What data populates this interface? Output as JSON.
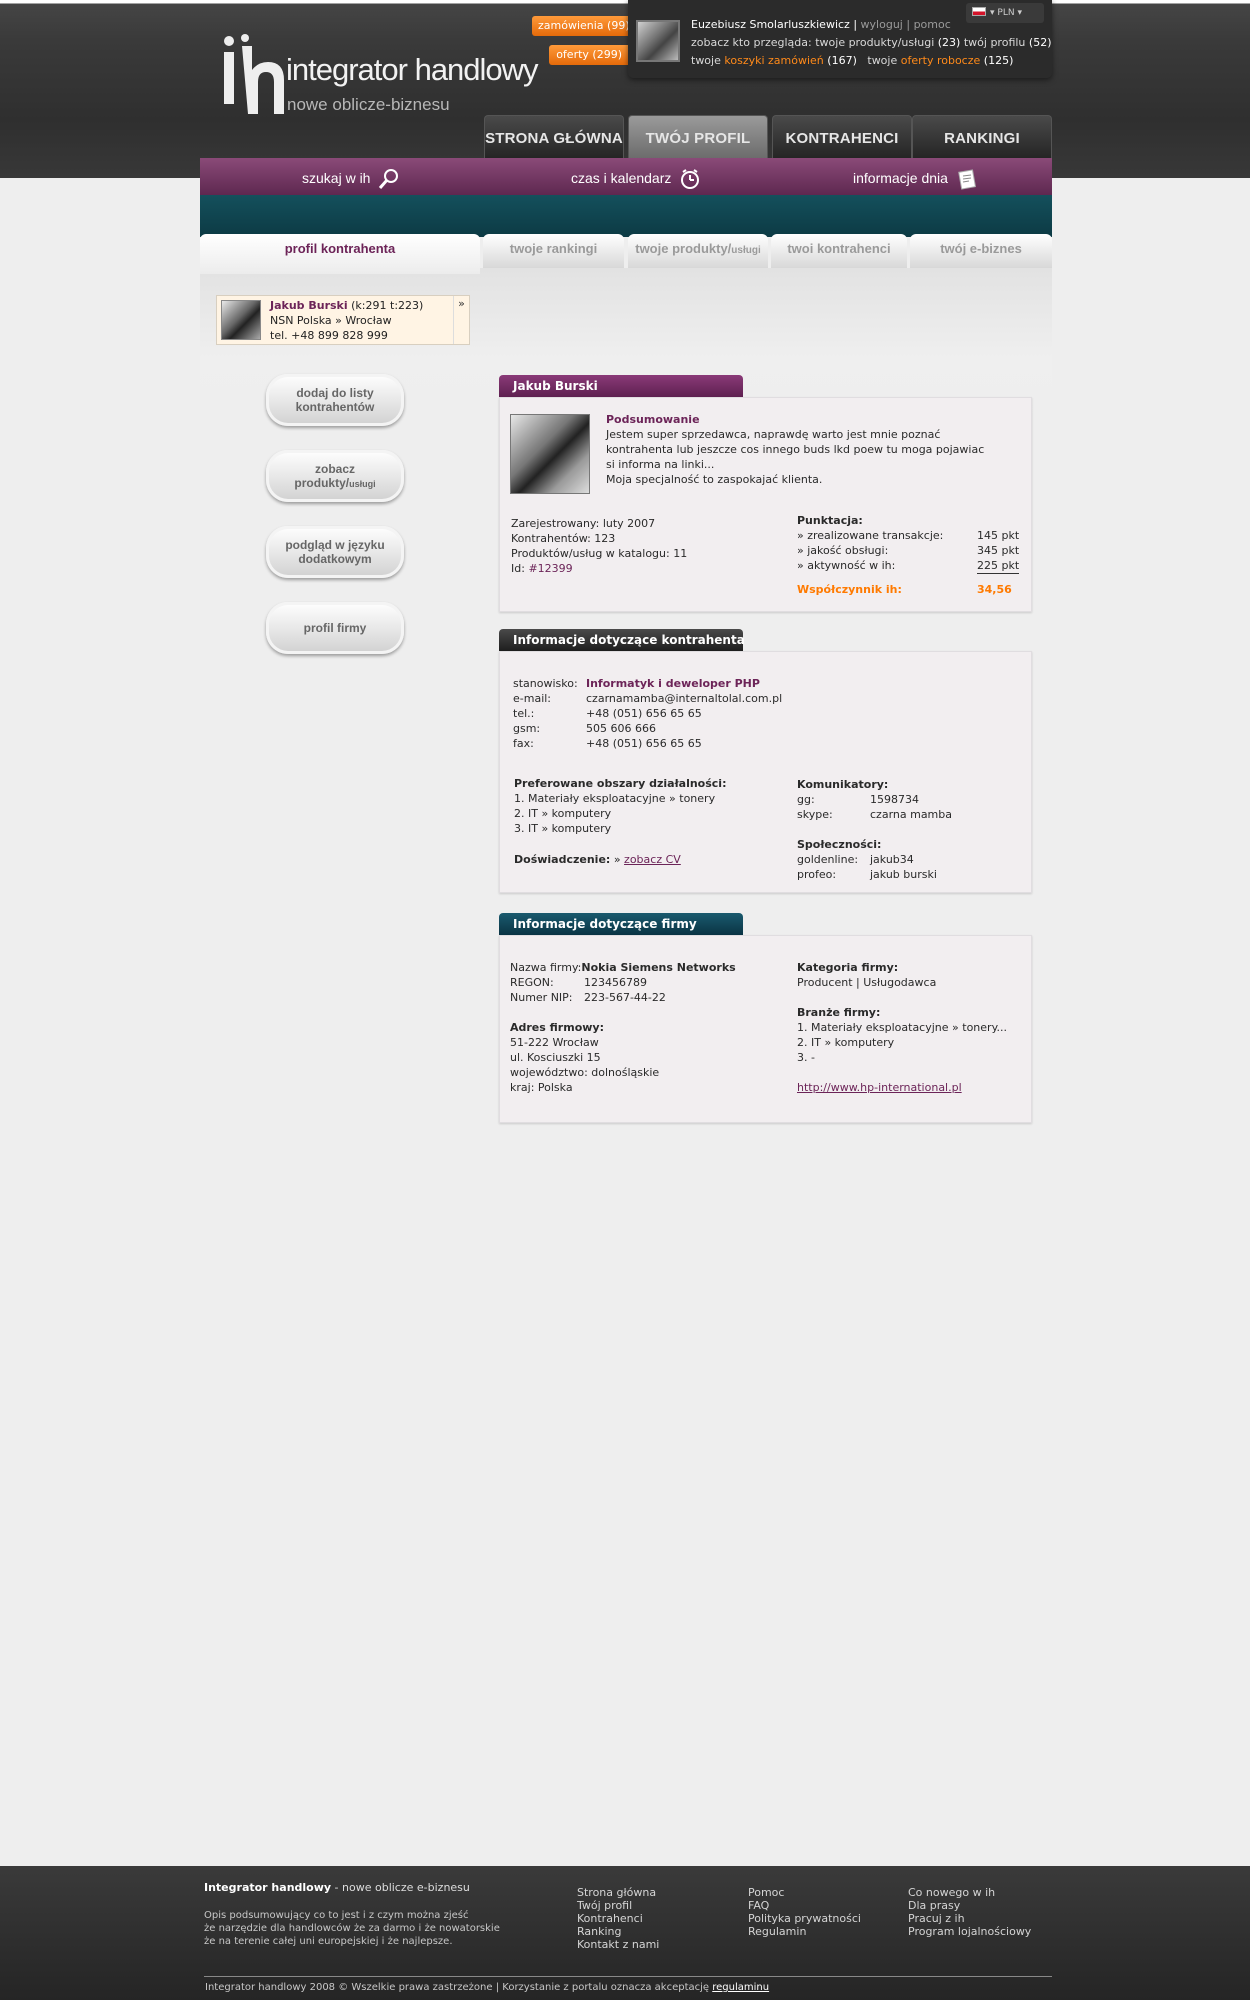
{
  "header": {
    "logo_text": "integrator handlowy",
    "logo_tagline": "nowe oblicze-biznesu",
    "orders_badge": "zamówienia (99)",
    "offers_badge": "oferty (299)",
    "currency": "PLN",
    "user": {
      "name": "Euzebiusz Smolarluszkiewicz",
      "sep1": "|",
      "logout": "wyloguj",
      "sep2": "|",
      "help": "pomoc",
      "views_prefix": "zobacz kto przegląda:",
      "views_products": "twoje produkty/usługi",
      "views_products_count": "(23)",
      "views_profile": "twój profilu",
      "views_profile_count": "(52)",
      "carts_prefix": "twoje",
      "carts_link": "koszyki zamówień",
      "carts_count": "(167)",
      "drafts_prefix": "twoje",
      "drafts_link": "oferty robocze",
      "drafts_count": "(125)"
    },
    "nav": [
      "STRONA GŁÓWNA",
      "TWÓJ PROFIL",
      "KONTRAHENCI",
      "RANKINGI"
    ],
    "toolbar": {
      "search": "szukaj w ih",
      "calendar": "czas i kalendarz",
      "news": "informacje dnia"
    }
  },
  "subtabs": {
    "profile": "profil kontrahenta",
    "rankings": "twoje rankingi",
    "products_main": "twoje produkty/",
    "products_small": "usługi",
    "contractors": "twoi kontrahenci",
    "ebusiness": "twój e-biznes"
  },
  "contact_card": {
    "name": "Jakub Burski",
    "stats": "(k:291 t:223)",
    "company": "NSN Polska » Wrocław",
    "phone": "tel. +48 899 828 999",
    "more": "»"
  },
  "side_buttons": {
    "add": "dodaj do listy kontrahentów",
    "products_main": "zobacz produkty/",
    "products_small": "usługi",
    "language": "podgląd w języku dodatkowym",
    "company": "profil firmy"
  },
  "summary": {
    "header": "Jakub Burski",
    "title": "Podsumowanie",
    "lines": [
      "Jestem super sprzedawca, naprawdę warto jest mnie poznać",
      "kontrahenta lub jeszcze cos innego buds lkd poew tu moga pojawiac",
      "si informa na linki...",
      "Moja specjalność to zaspokajać klienta."
    ],
    "registered": "Zarejestrowany: luty 2007",
    "contractors": "Kontrahentów: 123",
    "products": "Produktów/usług w katalogu: 11",
    "id_label": "Id:",
    "id_value": "#12399",
    "points_title": "Punktacja:",
    "points": [
      {
        "label": "» zrealizowane transakcje:",
        "value": "145 pkt"
      },
      {
        "label": "» jakość obsługi:",
        "value": "345 pkt"
      },
      {
        "label": "» aktywność w ih:",
        "value": "225 pkt"
      }
    ],
    "factor_label": "Współczynnik ih:",
    "factor_value": "34,56"
  },
  "contractor_info": {
    "header": "Informacje dotyczące kontrahenta",
    "fields": [
      {
        "label": "stanowisko:",
        "value": "Informatyk i deweloper PHP"
      },
      {
        "label": "e-mail:",
        "value": "czarnamamba@internaltolal.com.pl"
      },
      {
        "label": "tel.:",
        "value": "+48 (051) 656 65 65"
      },
      {
        "label": "gsm:",
        "value": "505 606 666"
      },
      {
        "label": "fax:",
        "value": "+48 (051) 656 65 65"
      }
    ],
    "areas_title": "Preferowane obszary działalności:",
    "areas": [
      "1. Materiały eksploatacyjne » tonery",
      "2. IT » komputery",
      "3. IT » komputery"
    ],
    "experience_label": "Doświadczenie:",
    "experience_prefix": "»",
    "experience_link": "zobacz CV",
    "messengers_title": "Komunikatory:",
    "messengers": [
      {
        "label": "gg:",
        "value": "1598734"
      },
      {
        "label": "skype:",
        "value": "czarna mamba"
      }
    ],
    "communities_title": "Społeczności:",
    "communities": [
      {
        "label": "goldenline:",
        "value": "jakub34"
      },
      {
        "label": "profeo:",
        "value": "jakub burski"
      }
    ]
  },
  "company_info": {
    "header": "Informacje dotyczące firmy",
    "name_label": "Nazwa firmy:",
    "name_value": "Nokia Siemens Networks",
    "regon_label": "REGON:",
    "regon_value": "123456789",
    "nip_label": "Numer NIP:",
    "nip_value": "223-567-44-22",
    "address_title": "Adres firmowy:",
    "address": [
      "51-222 Wrocław",
      "ul. Kosciuszki 15",
      "województwo: dolnośląskie",
      "kraj: Polska"
    ],
    "category_title": "Kategoria firmy:",
    "category": "Producent | Usługodawca",
    "branches_title": "Branże firmy:",
    "branches": [
      "1. Materiały eksploatacyjne » tonery...",
      "2. IT » komputery",
      "3. -"
    ],
    "website": "http://www.hp-international.pl"
  },
  "footer": {
    "brand": "Integrator handlowy",
    "brand_suffix": " - nowe oblicze e-biznesu",
    "desc": [
      "Opis podsumowujący co to jest i z czym można zjeść",
      "że narzędzie dla handlowców że za darmo i że nowatorskie",
      "że na terenie całej uni europejskiej i że najlepsze."
    ],
    "col1": [
      "Strona główna",
      "Twój profil",
      "Kontrahenci",
      "Ranking",
      "Kontakt z nami"
    ],
    "col2": [
      "Pomoc",
      "FAQ",
      "Polityka prywatności",
      "Regulamin"
    ],
    "col3": [
      "Co nowego w ih",
      "Dla prasy",
      "Pracuj z ih",
      "Program lojalnościowy"
    ],
    "copyright": "Integrator handlowy 2008 © Wszelkie prawa zastrzeżone  |  Korzystanie z portalu oznacza akceptację",
    "terms_link": "regulaminu"
  },
  "colors": {
    "accent_purple": "#6c2458",
    "accent_orange": "#ff7a00",
    "teal": "#0c3a44"
  }
}
